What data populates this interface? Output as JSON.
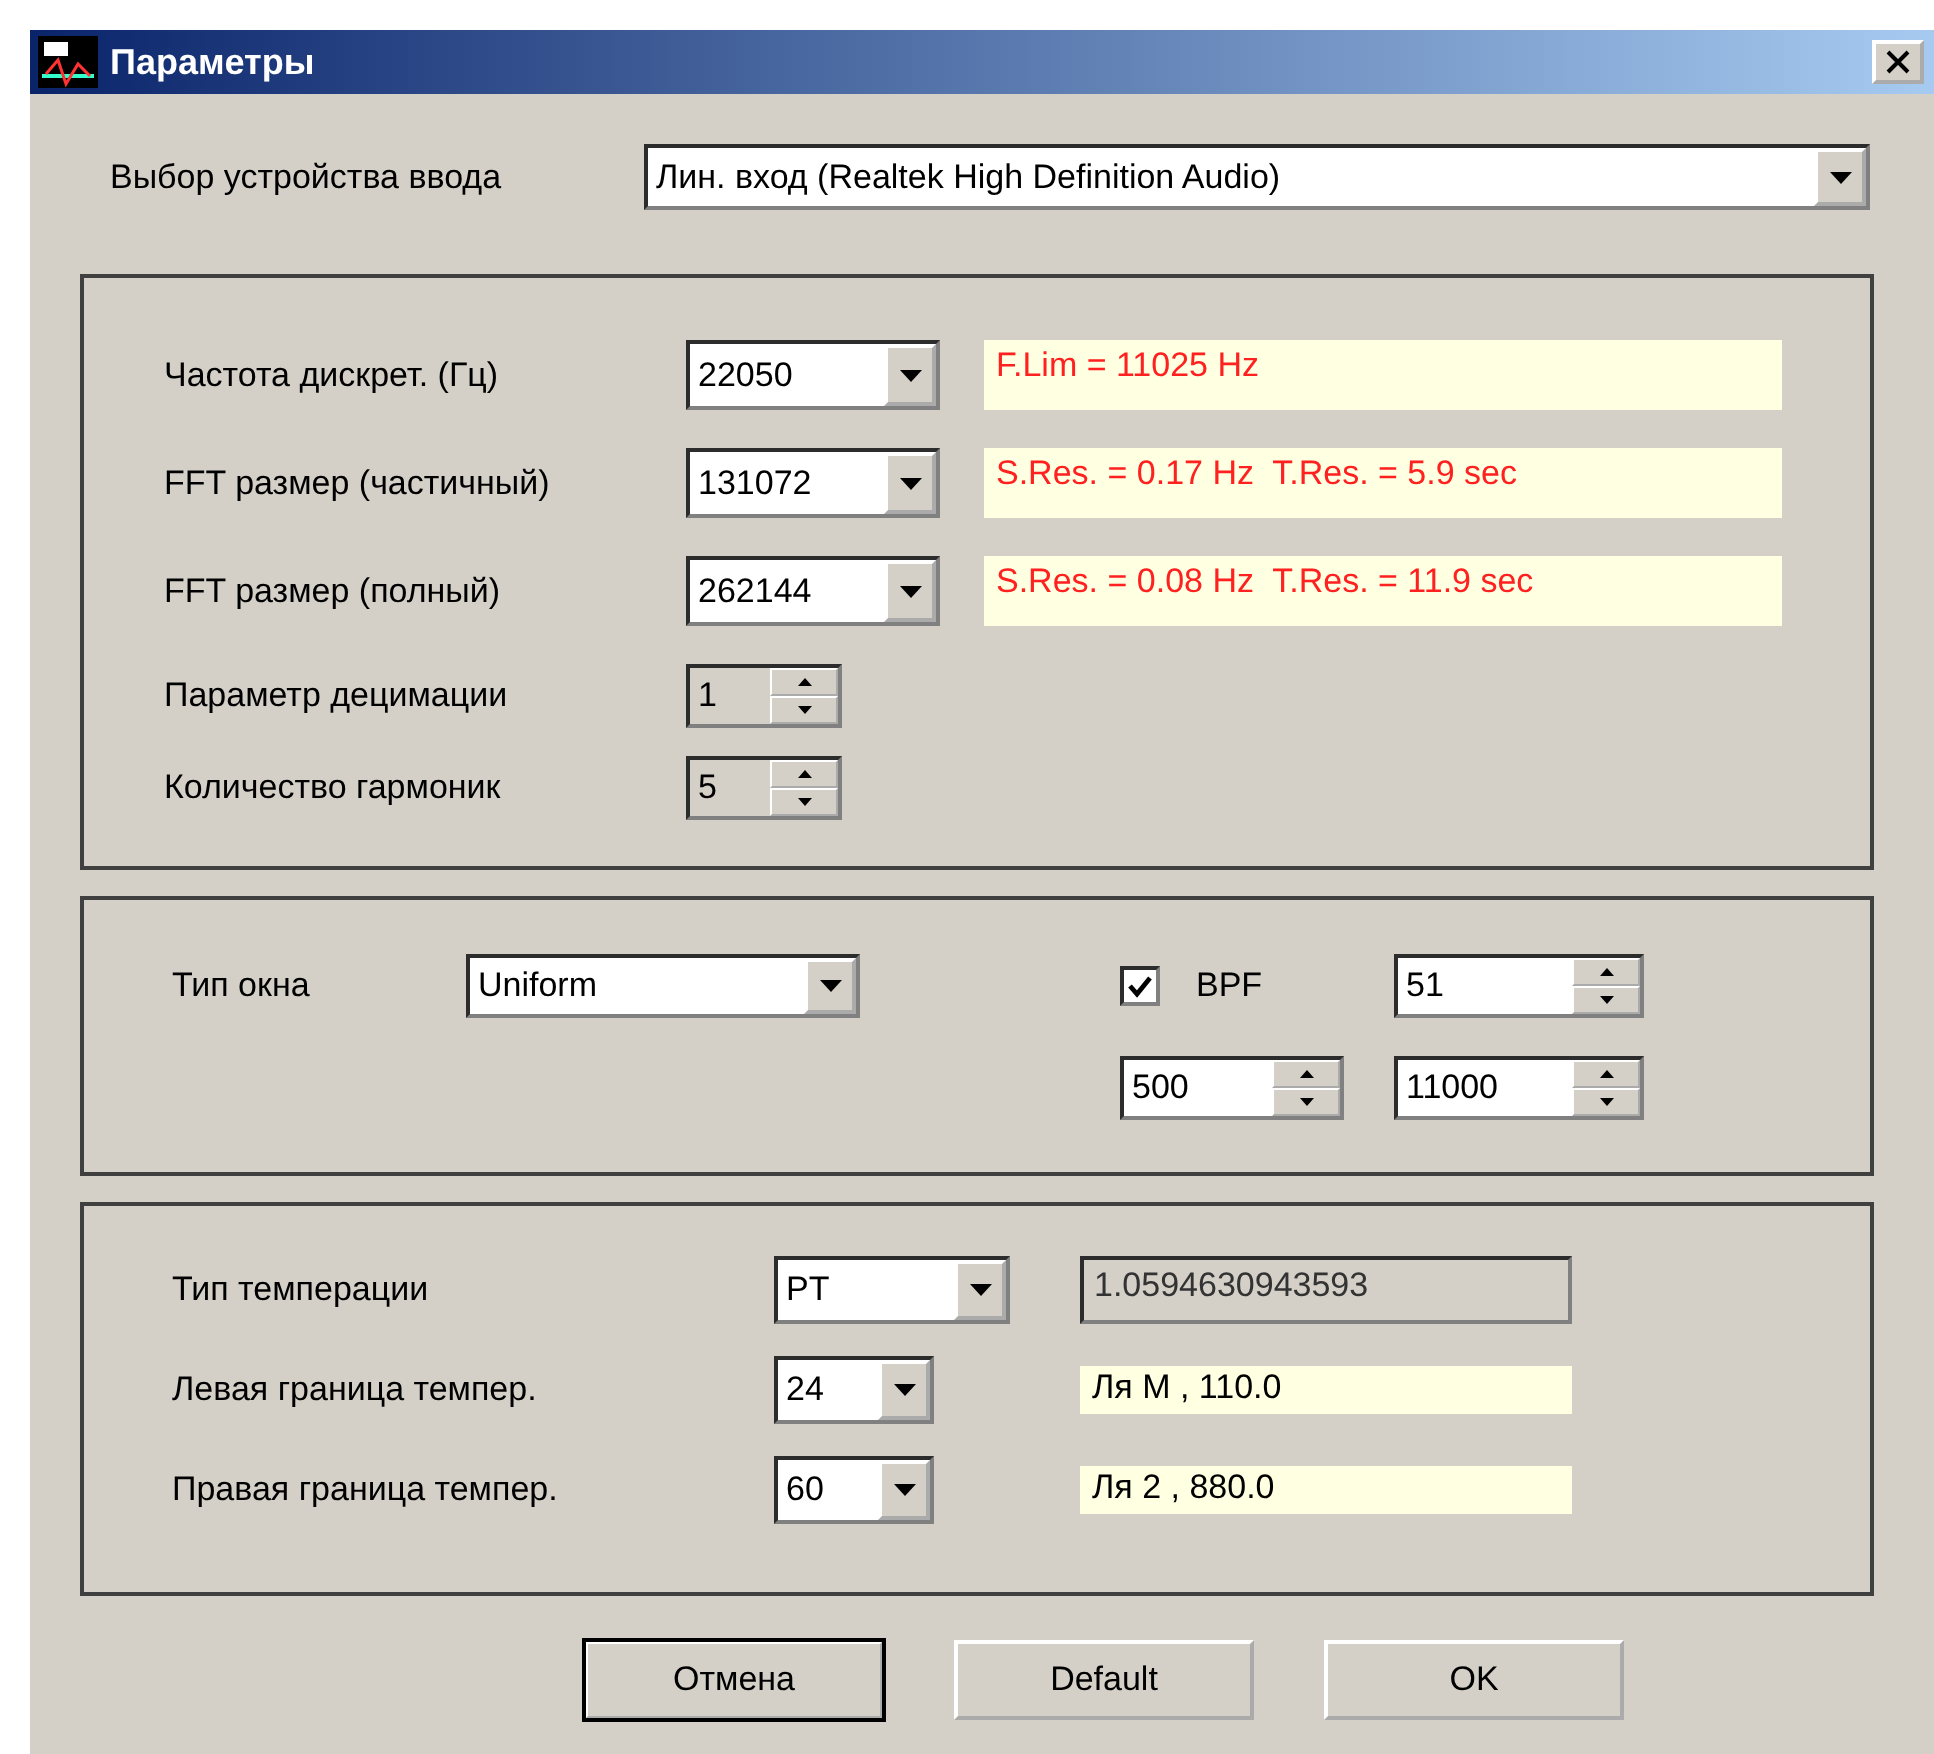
{
  "window": {
    "title": "Параметры"
  },
  "input_device": {
    "label": "Выбор устройства ввода",
    "value": "Лин. вход (Realtek High Definition Audio)"
  },
  "sampling": [
    {
      "label": "Частота дискрет. (Гц)",
      "value": "22050",
      "info": "F.Lim = 11025 Hz"
    },
    {
      "label": "FFT размер (частичный)",
      "value": "131072",
      "info": "S.Res. = 0.17 Hz  T.Res. = 5.9 sec"
    },
    {
      "label": "FFT размер (полный)",
      "value": "262144",
      "info": "S.Res. = 0.08 Hz  T.Res. = 11.9 sec"
    }
  ],
  "spinners": [
    {
      "label": "Параметр децимации",
      "value": "1"
    },
    {
      "label": "Количество гармоник",
      "value": "5"
    }
  ],
  "window_type": {
    "label": "Тип окна",
    "value": "Uniform"
  },
  "bpf": {
    "label": "BPF",
    "checked": true,
    "order": "51",
    "low": "500",
    "high": "11000"
  },
  "temperament": [
    {
      "label": "Тип темперации",
      "value": "PT",
      "info": "1.0594630943593",
      "kind": "readonly"
    },
    {
      "label": "Левая граница темпер.",
      "value": "24",
      "info": "Ля М , 110.0",
      "kind": "note"
    },
    {
      "label": "Правая граница темпер.",
      "value": "60",
      "info": "Ля 2 , 880.0",
      "kind": "note"
    }
  ],
  "buttons": [
    {
      "label": "Отмена",
      "default": true
    },
    {
      "label": "Default",
      "default": false
    },
    {
      "label": "OK",
      "default": false
    }
  ]
}
